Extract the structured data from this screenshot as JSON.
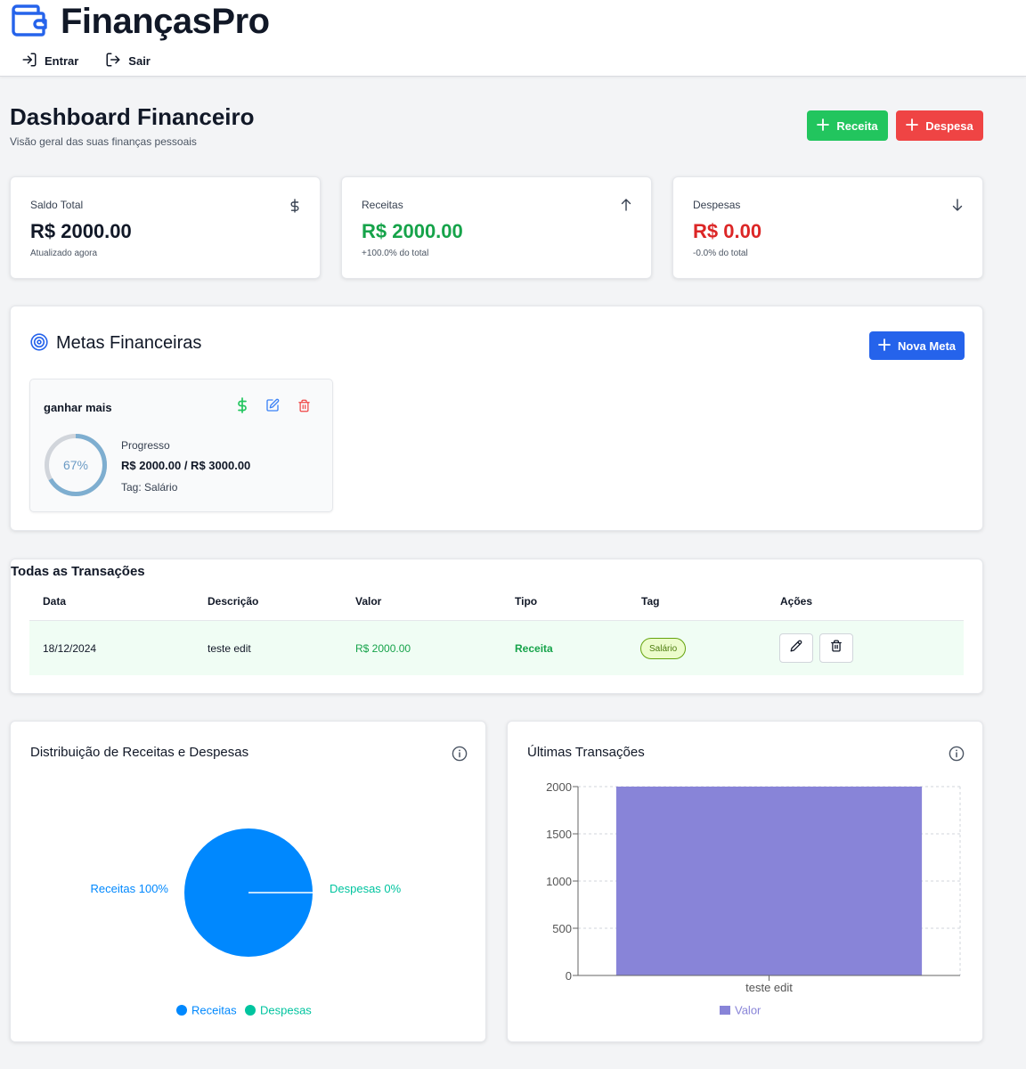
{
  "header": {
    "brand": "FinançasPro",
    "nav": [
      {
        "label": "Entrar",
        "icon": "login-icon"
      },
      {
        "label": "Sair",
        "icon": "logout-icon"
      }
    ]
  },
  "page": {
    "title": "Dashboard Financeiro",
    "subtitle": "Visão geral das suas finanças pessoais",
    "add_income_label": "Receita",
    "add_expense_label": "Despesa"
  },
  "stats": [
    {
      "label": "Saldo Total",
      "icon": "dollar-icon",
      "value": "R$ 2000.00",
      "note": "Atualizado agora",
      "color": "#111827"
    },
    {
      "label": "Receitas",
      "icon": "arrow-up-icon",
      "value": "R$ 2000.00",
      "note": "+100.0% do total",
      "color": "#16a34a"
    },
    {
      "label": "Despesas",
      "icon": "arrow-down-icon",
      "value": "R$ 0.00",
      "note": "-0.0% do total",
      "color": "#dc2626"
    }
  ],
  "goals": {
    "title": "Metas Financeiras",
    "new_label": "Nova Meta",
    "items": [
      {
        "name": "ganhar mais",
        "progress_label": "Progresso",
        "percent_label": "67%",
        "progress": 0.667,
        "amount": "R$ 2000.00 / R$ 3000.00",
        "tag": "Tag: Salário"
      }
    ]
  },
  "transactions": {
    "title": "Todas as Transações",
    "columns": [
      "Data",
      "Descrição",
      "Valor",
      "Tipo",
      "Tag",
      "Ações"
    ],
    "rows": [
      {
        "date": "18/12/2024",
        "description": "teste edit",
        "value": "R$ 2000.00",
        "type": "Receita",
        "tag": "Salário"
      }
    ]
  },
  "pie_chart": {
    "title": "Distribuição de Receitas e Despesas",
    "chart_data": {
      "type": "pie",
      "categories": [
        "Receitas",
        "Despesas"
      ],
      "values": [
        100,
        0
      ],
      "labels": [
        "Receitas 100%",
        "Despesas 0%"
      ],
      "colors": [
        "#0088fe",
        "#00c49f"
      ],
      "legend": [
        "Receitas",
        "Despesas"
      ]
    }
  },
  "bar_chart": {
    "title": "Últimas Transações",
    "chart_data": {
      "type": "bar",
      "categories": [
        "teste edit"
      ],
      "series": [
        {
          "name": "Valor",
          "values": [
            2000
          ]
        }
      ],
      "ylim": [
        0,
        2000
      ],
      "yticks": [
        "0",
        "500",
        "1000",
        "1500",
        "2000"
      ],
      "color": "#8884d8",
      "grid": true,
      "legend": "bottom"
    }
  },
  "colors": {
    "brand": "#2563eb",
    "income": "#22c55e",
    "expense": "#ef4444"
  }
}
